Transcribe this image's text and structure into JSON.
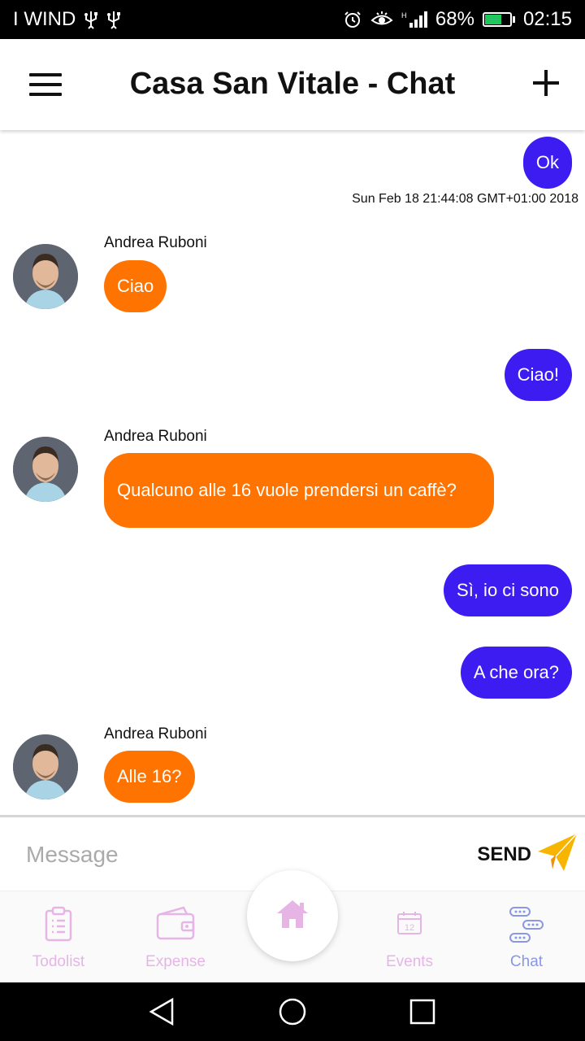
{
  "status_bar": {
    "carrier": "I WIND",
    "battery_percent": "68%",
    "time": "02:15",
    "icons": [
      "usb-icon",
      "usb-icon",
      "alarm-icon",
      "eye-icon",
      "signal-icon",
      "battery-icon"
    ]
  },
  "app_bar": {
    "title": "Casa San Vitale - Chat"
  },
  "chat": {
    "messages": [
      {
        "direction": "out",
        "text": "Ok"
      },
      {
        "direction": "in",
        "sender": "Andrea Ruboni",
        "text": "Ciao"
      },
      {
        "direction": "out",
        "text": "Ciao!"
      },
      {
        "direction": "in",
        "sender": "Andrea Ruboni",
        "text": "Qualcuno alle 16 vuole prendersi un caffè?"
      },
      {
        "direction": "out",
        "text": "Sì, io ci sono"
      },
      {
        "direction": "out",
        "text": "A che ora?"
      },
      {
        "direction": "in",
        "sender": "Andrea Ruboni",
        "text": "Alle 16?"
      }
    ],
    "timestamp": "Sun Feb 18 21:44:08 GMT+01:00 2018"
  },
  "composer": {
    "placeholder": "Message",
    "value": "",
    "send_label": "SEND"
  },
  "bottom_nav": {
    "items": [
      {
        "label": "Todolist",
        "icon": "clipboard-icon"
      },
      {
        "label": "Expense",
        "icon": "wallet-icon"
      },
      {
        "label": "",
        "icon": "home-icon"
      },
      {
        "label": "Events",
        "icon": "calendar-icon"
      },
      {
        "label": "Chat",
        "icon": "chat-icon"
      }
    ],
    "calendar_day": "12",
    "active": "Chat"
  },
  "colors": {
    "outgoing_bubble": "#3d1cf2",
    "incoming_bubble": "#ff7300",
    "nav_inactive": "#e6b5e6",
    "nav_active": "#8a96e6",
    "send_icon": "#f7b500"
  }
}
